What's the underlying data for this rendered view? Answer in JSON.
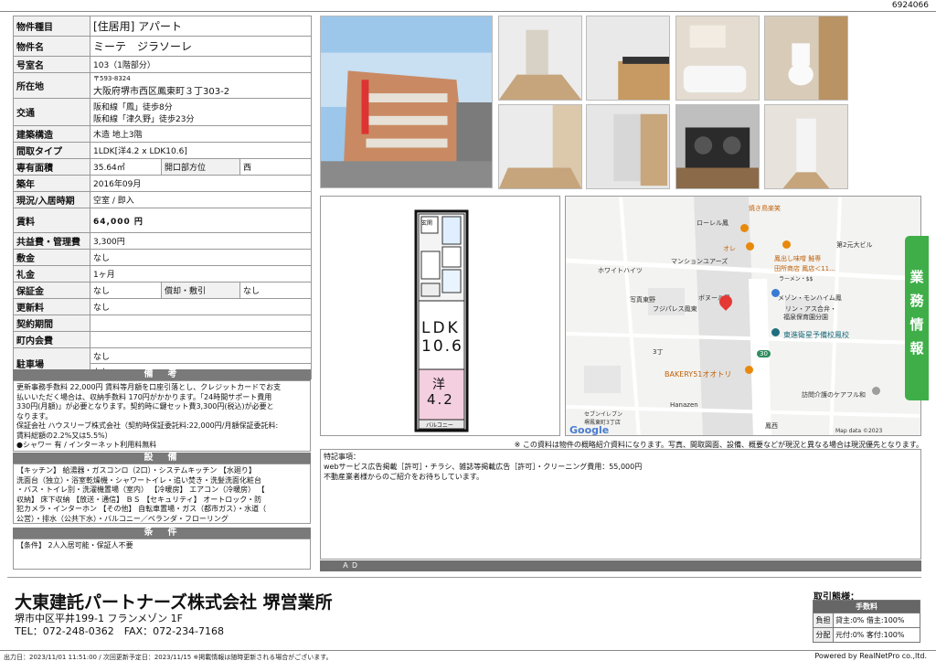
{
  "property_id": "6924066",
  "spec": {
    "type_label": "物件種目",
    "type_value": "[住居用] アパート",
    "name_label": "物件名",
    "name_value": "ミーテ　ジラソーレ",
    "room_label": "号室名",
    "room_value": "103（1階部分）",
    "location_label": "所在地",
    "postal": "〒593-8324",
    "address": "大阪府堺市西区鳳東町３丁303-2",
    "transport_label": "交通",
    "transport_1": "阪和線「鳳」徒歩8分",
    "transport_2": "阪和線「津久野」徒歩23分",
    "structure_label": "建築構造",
    "structure_value": "木造 地上3階",
    "layout_label": "間取タイプ",
    "layout_value": "1LDK[洋4.2 x LDK10.6]",
    "area_label": "専有面積",
    "area_value": "35.64㎡",
    "direction_label": "開口部方位",
    "direction_value": "西",
    "built_label": "築年",
    "built_value": "2016年09月",
    "status_label": "現況/入居時期",
    "status_value": "空室 / 即入",
    "rent_label": "賃料",
    "rent_value": "64,000 円",
    "fee_label": "共益費・管理費",
    "fee_value": "3,300円",
    "deposit_label": "敷金",
    "deposit_value": "なし",
    "key_label": "礼金",
    "key_value": "1ヶ月",
    "guarantee_label": "保証金",
    "guarantee_value": "なし",
    "amort_label": "償却・敷引",
    "amort_value": "なし",
    "renew_label": "更新料",
    "renew_value": "なし",
    "contract_label": "契約期間",
    "contract_value": "",
    "assoc_label": "町内会費",
    "assoc_value": "",
    "parking_label": "駐車場",
    "parking_value_1": "なし",
    "parking_value_2": "なし"
  },
  "remarks": {
    "title": "備　考",
    "lines": [
      "更新事務手数料 22,000円 賃料等月額を口座引落とし、クレジットカードでお支",
      "払いいただく場合は、収納手数料 170円がかかります。「24時間サポート費用",
      "330円(月額)」が必要となります。契約時に鍵セット費3,300円(税込)が必要と",
      "なります。",
      "保証会社 ハウスリーブ株式会社（契約時保証委託料:22,000円/月額保証委託料:",
      "賃料総額の2.2%又は5.5%）",
      "●シャワー 有 / インターネット利用料無料"
    ]
  },
  "equipment": {
    "title": "設　備",
    "lines": [
      "【キッチン】 給湯器・ガスコンロ（2口）・システムキッチン 【水廻り】",
      "洗面台（独立）・浴室乾燥機・シャワートイレ・追い焚き・洗髪洗面化粧台",
      "・バス・トイレ別・洗濯機置場（室内） 【冷暖房】 エアコン（冷暖房） 【",
      "収納】 床下収納 【放送・通信】 ＢＳ 【セキュリティ】 オートロック・防",
      "犯カメラ・インターホン 【その他】 自転車置場・ガス（都市ガス）・水道（",
      "公営）・排水（公共下水）・バルコニー／ベランダ・フローリング"
    ]
  },
  "conditions": {
    "title": "条　件",
    "text": "【条件】 2人入居可能・保証人不要"
  },
  "floorplan": {
    "ldk": "LDK",
    "ldk_size": "10.6",
    "western": "洋",
    "western_size": "4.2",
    "balcony": "バルコニー",
    "entrance": "玄関"
  },
  "map": {
    "labels": [
      "焼き鳥楽笑",
      "ローレル鳳",
      "オレ",
      "鳳出し味噌 鮭専",
      "田所商店 鳳店＜11…",
      "ラーメン・$$",
      "第2元大ビル",
      "マンションユアーズ",
      "ホワイトハイツ",
      "ボヌール鳳",
      "写真東野",
      "フジパレス鳳東",
      "メゾン・モンハイム鳳",
      "リン・アス合弁・",
      "福泉保育園分園",
      "東進衛星予備校鳳校",
      "3丁",
      "BAKERY51オオトリ",
      "訪問介護のケアフル和",
      "Hanazen",
      "セブンイレブン",
      "堺鳳東町3丁店",
      "鳳西",
      "Google",
      "Map data ©2023",
      "30"
    ]
  },
  "side_tab": {
    "chars": [
      "業",
      "務",
      "情",
      "報"
    ]
  },
  "note": "※ この資料は物件の概略紹介資料になります。写真、間取図面、設備、概要などが現況と異なる場合は現況優先となります。",
  "memo": {
    "title": "特記事項：",
    "line1": "webサービス広告掲載［許可］・チラシ、雑誌等掲載広告［許可］・クリーニング費用：55,000円",
    "line2": "不動産業者様からのご紹介をお待ちしています。"
  },
  "ad_label": "ＡＤ",
  "company": {
    "name": "大東建託パートナーズ株式会社 堺営業所",
    "address": "堺市中区平井199-1 フランメゾン 1F",
    "tel": "TEL：072-248-0362　FAX：072-234-7168"
  },
  "torihiki": {
    "title": "取引態様：",
    "header": "手数料",
    "row1_key": "負担",
    "row1_val": "貸主:0% 借主:100%",
    "row2_key": "分配",
    "row2_val": "元付:0% 客付:100%"
  },
  "footer": {
    "text": "出力日：2023/11/01 11:51:00 / 次回更新予定日：2023/11/15 ※掲載情報は随時更新される場合がございます。",
    "powered": "Powered by RealNetPro co.,ltd."
  },
  "colors": {
    "accent_green": "#3fae49",
    "section_gray": "#7a7a7a",
    "pin_red": "#e53935",
    "map_orange": "#e8890c"
  }
}
